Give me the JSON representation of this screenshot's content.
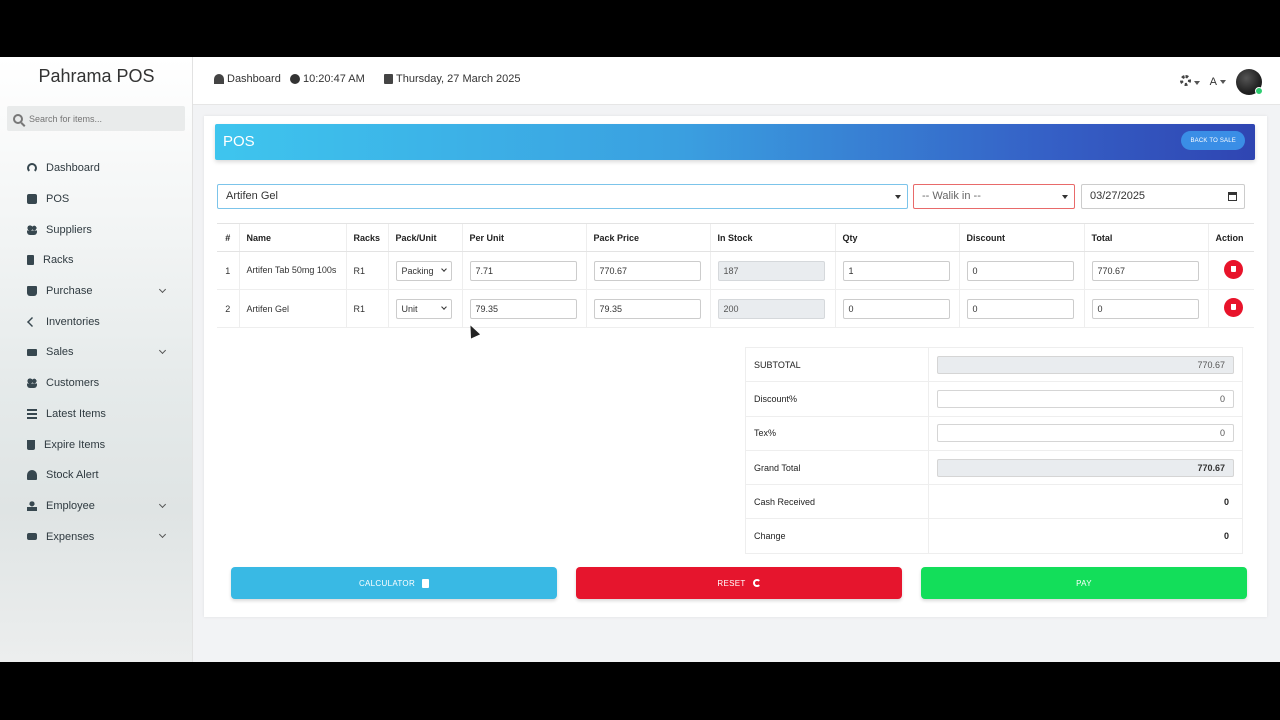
{
  "sidebar": {
    "brand": "Pahrama POS",
    "search_placeholder": "Search for items...",
    "items": [
      {
        "label": "Dashboard"
      },
      {
        "label": "POS"
      },
      {
        "label": "Suppliers"
      },
      {
        "label": "Racks"
      },
      {
        "label": "Purchase"
      },
      {
        "label": "Inventories"
      },
      {
        "label": "Sales"
      },
      {
        "label": "Customers"
      },
      {
        "label": "Latest Items"
      },
      {
        "label": "Expire Items"
      },
      {
        "label": "Stock Alert"
      },
      {
        "label": "Employee"
      },
      {
        "label": "Expenses"
      }
    ]
  },
  "topbar": {
    "dashboard": "Dashboard",
    "time": "10:20:47 AM",
    "date": "Thursday, 27 March 2025",
    "lang": "A"
  },
  "pos": {
    "title": "POS",
    "back_label": "BACK TO SALE",
    "product_select": "Artifen Gel",
    "customer_select": "-- Walik in --",
    "date": "03/27/2025"
  },
  "table": {
    "headers": [
      "#",
      "Name",
      "Racks",
      "Pack/Unit",
      "Per Unit",
      "Pack Price",
      "In Stock",
      "Qty",
      "Discount",
      "Total",
      "Action"
    ],
    "rows": [
      {
        "no": "1",
        "name": "Artifen Tab 50mg 100s",
        "rack": "R1",
        "unit": "Packing",
        "per_unit": "7.71",
        "pack_price": "770.67",
        "stock": "187",
        "qty": "1",
        "discount": "0",
        "total": "770.67"
      },
      {
        "no": "2",
        "name": "Artifen Gel",
        "rack": "R1",
        "unit": "Unit",
        "per_unit": "79.35",
        "pack_price": "79.35",
        "stock": "200",
        "qty": "0",
        "discount": "0",
        "total": "0"
      }
    ]
  },
  "summary": {
    "subtotal_label": "SUBTOTAL",
    "subtotal": "770.67",
    "discount_label": "Discount%",
    "discount": "0",
    "tax_label": "Tex%",
    "tax": "0",
    "grand_label": "Grand Total",
    "grand": "770.67",
    "cash_label": "Cash Received",
    "cash": "0",
    "change_label": "Change",
    "change": "0"
  },
  "actions": {
    "calculator": "CALCULATOR",
    "reset": "RESET",
    "pay": "PAY"
  },
  "colors": {
    "calc": "#39b9e4",
    "reset": "#e6152d",
    "pay": "#13de5a",
    "header_start": "#3ec5ee",
    "header_end": "#2f45b2"
  }
}
